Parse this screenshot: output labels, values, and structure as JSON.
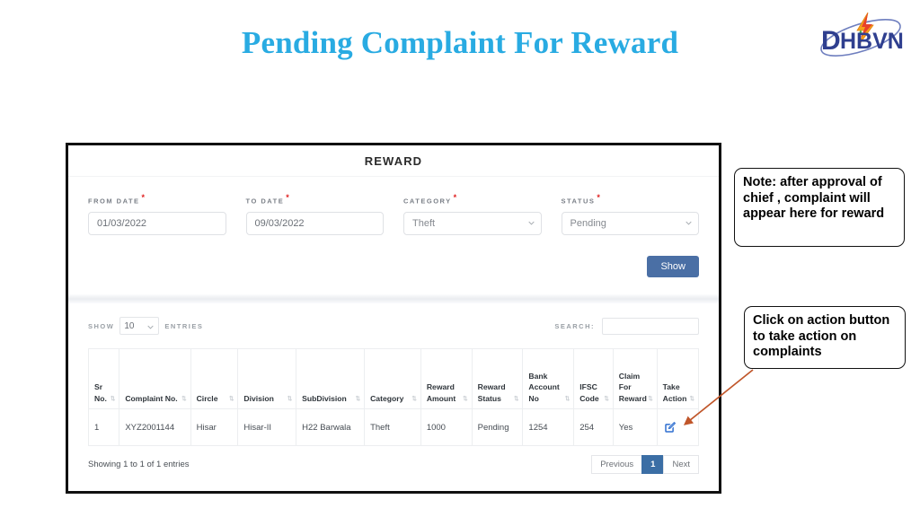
{
  "slide": {
    "title": "Pending Complaint For Reward",
    "title_color": "#29ABE2"
  },
  "logo": {
    "name": "dhbvn-logo",
    "text": "DHBVN",
    "text_color": "#2f3f8f"
  },
  "card": {
    "header_title": "REWARD",
    "form": {
      "fields": [
        {
          "label": "FROM DATE",
          "required": "*",
          "value": "01/03/2022",
          "type": "text"
        },
        {
          "label": "TO DATE",
          "required": "*",
          "value": "09/03/2022",
          "type": "text"
        },
        {
          "label": "CATEGORY",
          "required": "*",
          "value": "Theft",
          "type": "select"
        },
        {
          "label": "STATUS",
          "required": "*",
          "value": "Pending",
          "type": "select"
        }
      ],
      "submit_label": "Show",
      "submit_color": "#4a6fa5"
    },
    "table_controls": {
      "show_label": "SHOW",
      "entries_value": "10",
      "entries_label": "ENTRIES",
      "search_label": "SEARCH:",
      "search_value": "",
      "search_placeholder": ""
    },
    "table": {
      "columns": [
        "Sr No.",
        "Complaint No.",
        "Circle",
        "Division",
        "SubDivision",
        "Category",
        "Reward Amount",
        "Reward Status",
        "Bank Account No",
        "IFSC Code",
        "Claim For Reward",
        "Take Action"
      ],
      "rows": [
        {
          "sr_no": "1",
          "complaint_no": "XYZ2001144",
          "circle": "Hisar",
          "division": "Hisar-II",
          "subdivision": "H22 Barwala",
          "category": "Theft",
          "reward_amount": "1000",
          "reward_status": "Pending",
          "bank_account_no": "1254",
          "ifsc_code": "254",
          "claim_for_reward": "Yes",
          "take_action": "edit-icon"
        }
      ]
    },
    "footer": {
      "showing_text": "Showing 1 to 1 of 1 entries",
      "pagination": {
        "previous": "Previous",
        "page": "1",
        "next": "Next",
        "active_color": "#3b6ea5"
      }
    }
  },
  "annotations": [
    {
      "id": "note",
      "text": "Note: after approval of chief , complaint will appear here for reward"
    },
    {
      "id": "action",
      "text": "Click on action button to take action on complaints",
      "arrow_color": "#c0562a"
    }
  ]
}
